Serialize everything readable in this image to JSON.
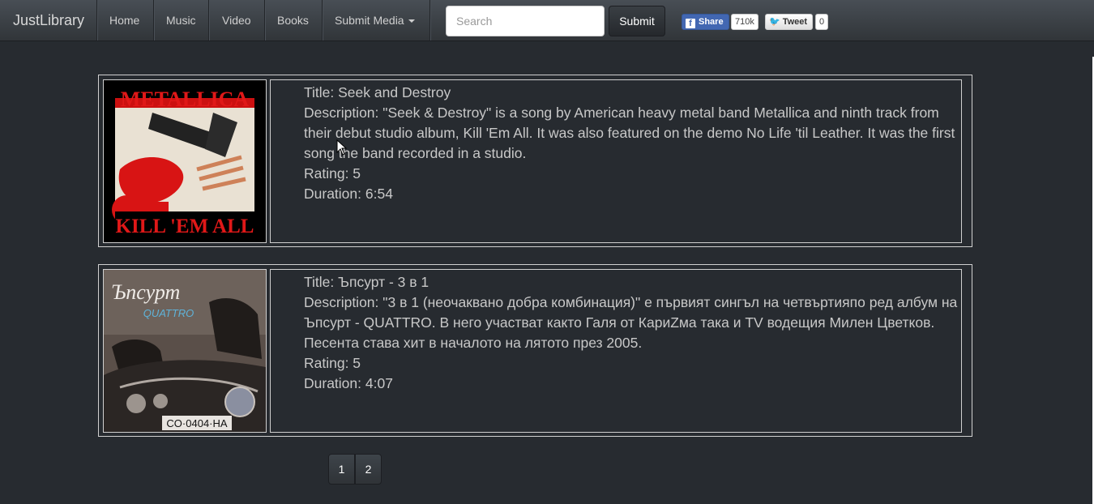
{
  "navbar": {
    "brand": "JustLibrary",
    "items": [
      {
        "label": "Home"
      },
      {
        "label": "Music"
      },
      {
        "label": "Video"
      },
      {
        "label": "Books"
      },
      {
        "label": "Submit Media"
      }
    ],
    "search_placeholder": "Search",
    "search_value": "",
    "submit_label": "Submit",
    "share_label": "Share",
    "share_count": "710k",
    "tweet_label": "Tweet",
    "tweet_count": "0"
  },
  "media": [
    {
      "title": "Title: Seek and Destroy",
      "description": "Description: \"Seek & Destroy\" is a song by American heavy metal band Metallica and ninth track from their debut studio album, Kill 'Em All. It was also featured on the demo No Life 'til Leather. It was the first song the band recorded in a studio.",
      "rating": "Rating: 5",
      "duration": "Duration: 6:54",
      "cover_band_text": "METALLICA",
      "cover_album_text": "KILL 'EM ALL"
    },
    {
      "title": "Title: Ъпсурт - 3 в 1",
      "description": "Description: \"3 в 1 (неочаквано добра комбинация)\" е първият сингъл на четвъртияпо ред албум на Ъпсурт - QUATTRO. В него участват както Галя от КариZма така и TV водещия Милен Цветков. Песента става хит в началото на лятото през 2005.",
      "rating": "Rating: 5",
      "duration": "Duration: 4:07",
      "cover_band_text": "Ъпсурт",
      "cover_album_text": "QUATTRO",
      "cover_plate_text": "CO·0404·HA"
    }
  ],
  "pagination": {
    "pages": [
      "1",
      "2"
    ]
  }
}
